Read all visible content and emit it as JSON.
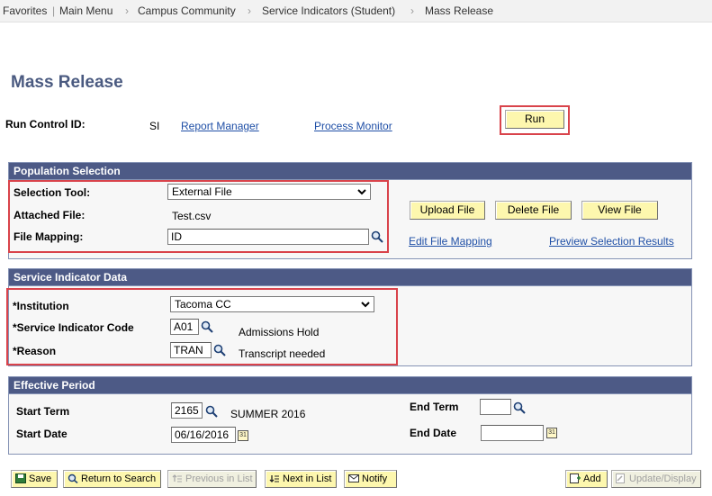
{
  "breadcrumb": [
    "Favorites",
    "Main Menu",
    "Campus Community",
    "Service Indicators (Student)",
    "Mass Release"
  ],
  "page_title": "Mass Release",
  "run_control": {
    "label": "Run Control ID:",
    "value": "SI",
    "report_manager": "Report Manager",
    "process_monitor": "Process Monitor",
    "run_label": "Run"
  },
  "population": {
    "header": "Population Selection",
    "selection_tool_label": "Selection Tool:",
    "selection_tool_value": "External File",
    "attached_file_label": "Attached File:",
    "attached_file_value": "Test.csv",
    "file_mapping_label": "File Mapping:",
    "file_mapping_value": "ID",
    "upload_file": "Upload File",
    "delete_file": "Delete File",
    "view_file": "View File",
    "edit_file_mapping": "Edit File Mapping",
    "preview_selection_results": "Preview Selection Results"
  },
  "service_indicator": {
    "header": "Service Indicator Data",
    "institution_label": "*Institution",
    "institution_value": "Tacoma CC",
    "code_label": "*Service Indicator Code",
    "code_value": "A01",
    "code_desc": "Admissions Hold",
    "reason_label": "*Reason",
    "reason_value": "TRAN",
    "reason_desc": "Transcript needed"
  },
  "effective_period": {
    "header": "Effective Period",
    "start_term_label": "Start Term",
    "start_term_value": "2165",
    "start_term_desc": "SUMMER 2016",
    "start_date_label": "Start Date",
    "start_date_value": "06/16/2016",
    "end_term_label": "End Term",
    "end_term_value": "",
    "end_date_label": "End Date",
    "end_date_value": ""
  },
  "toolbar": {
    "save": "Save",
    "return_to_search": "Return to Search",
    "previous_in_list": "Previous in List",
    "next_in_list": "Next in List",
    "notify": "Notify",
    "add": "Add",
    "update_display": "Update/Display"
  },
  "colors": {
    "section_header": "#4d5a86",
    "highlight_box": "#d9434b",
    "button_bg": "#fdf7ae",
    "link": "#1f4fa6",
    "title": "#4a5a80"
  }
}
